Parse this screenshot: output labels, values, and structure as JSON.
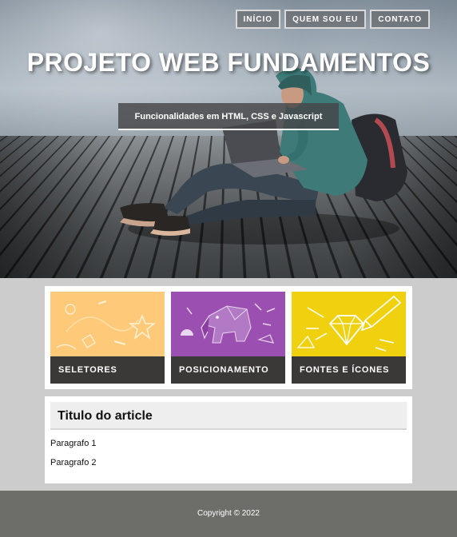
{
  "nav": {
    "items": [
      "INÍCIO",
      "QUEM SOU EU",
      "CONTATO"
    ]
  },
  "hero": {
    "title": "PROJETO WEB FUNDAMENTOS",
    "subtitle": "Funcionalidades em HTML, CSS e Javascript"
  },
  "cards": [
    {
      "label": "SELETORES",
      "color": "#ffc97a"
    },
    {
      "label": "POSICIONAMENTO",
      "color": "#9b4fb0"
    },
    {
      "label": "FONTES E ÍCONES",
      "color": "#f0d10f"
    }
  ],
  "article": {
    "title": "Titulo do article",
    "paragraphs": [
      "Paragrafo 1",
      "Paragrafo 2"
    ]
  },
  "footer": {
    "text": "Copyright © 2022"
  },
  "colors": {
    "card_label_bg": "#3b3838",
    "page_bg": "#cccccc",
    "footer_bg": "#6d6e69"
  }
}
